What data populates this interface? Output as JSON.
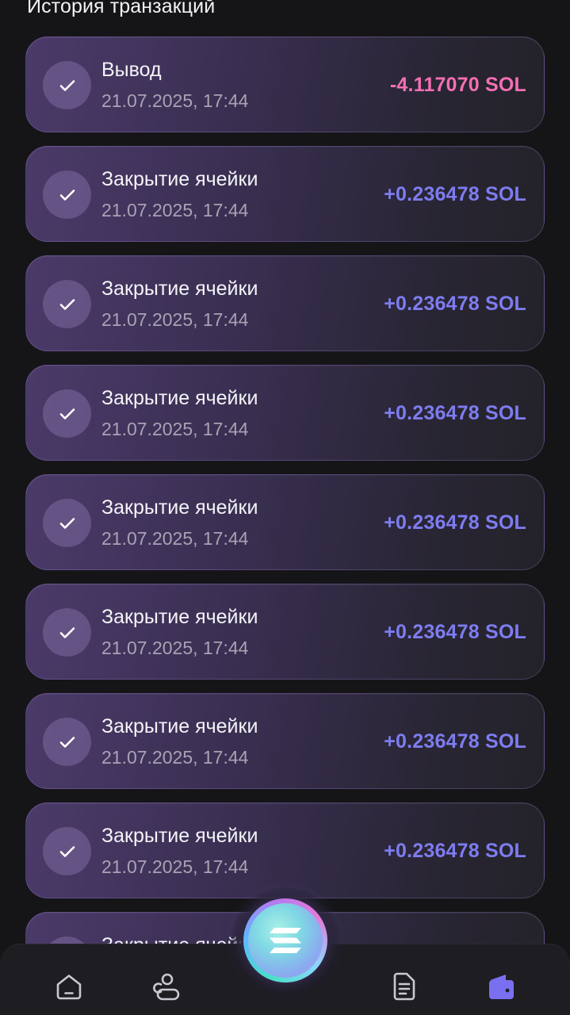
{
  "header": {
    "title": "История транзакций"
  },
  "transactions": [
    {
      "title": "Вывод",
      "date": "21.07.2025, 17:44",
      "amount": "-4.117070 SOL",
      "direction": "neg"
    },
    {
      "title": "Закрытие ячейки",
      "date": "21.07.2025, 17:44",
      "amount": "+0.236478 SOL",
      "direction": "pos"
    },
    {
      "title": "Закрытие ячейки",
      "date": "21.07.2025, 17:44",
      "amount": "+0.236478 SOL",
      "direction": "pos"
    },
    {
      "title": "Закрытие ячейки",
      "date": "21.07.2025, 17:44",
      "amount": "+0.236478 SOL",
      "direction": "pos"
    },
    {
      "title": "Закрытие ячейки",
      "date": "21.07.2025, 17:44",
      "amount": "+0.236478 SOL",
      "direction": "pos"
    },
    {
      "title": "Закрытие ячейки",
      "date": "21.07.2025, 17:44",
      "amount": "+0.236478 SOL",
      "direction": "pos"
    },
    {
      "title": "Закрытие ячейки",
      "date": "21.07.2025, 17:44",
      "amount": "+0.236478 SOL",
      "direction": "pos"
    },
    {
      "title": "Закрытие ячейки",
      "date": "21.07.2025, 17:44",
      "amount": "+0.236478 SOL",
      "direction": "pos"
    },
    {
      "title": "Закрытие ячейки",
      "date": "",
      "amount": "",
      "direction": "pos"
    }
  ],
  "tab_bar": {
    "items": [
      {
        "icon": "home-icon",
        "active": false
      },
      {
        "icon": "friends-icon",
        "active": false
      },
      {
        "icon": "solana-icon",
        "active": false
      },
      {
        "icon": "document-icon",
        "active": false
      },
      {
        "icon": "wallet-icon",
        "active": true
      }
    ]
  },
  "colors": {
    "negative": "#f46fb3",
    "positive": "#7e7cf0",
    "active_tab": "#7a6ff0",
    "inactive_tab": "#c9c9d2"
  }
}
